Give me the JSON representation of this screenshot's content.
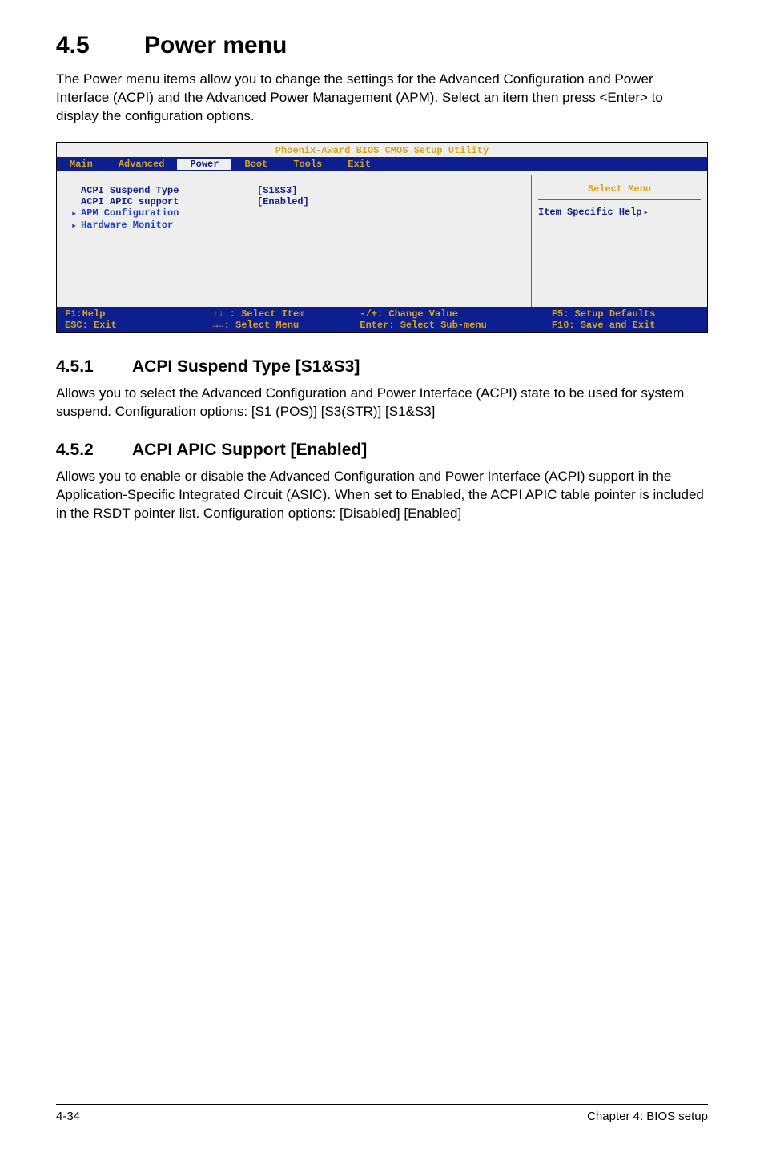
{
  "heading": {
    "number": "4.5",
    "title": "Power menu"
  },
  "intro": "The Power menu items allow you to change the settings for the Advanced Configuration and Power Interface (ACPI) and the Advanced Power Management (APM). Select an item then press <Enter> to display the configuration options.",
  "chart_data": {
    "type": "table",
    "title": "Phoenix-Award BIOS CMOS Setup Utility",
    "menubar": [
      "Main",
      "Advanced",
      "Power",
      "Boot",
      "Tools",
      "Exit"
    ],
    "active_tab": "Power",
    "rows": [
      {
        "label": "ACPI Suspend Type",
        "value": "[S1&S3]",
        "submenu": false
      },
      {
        "label": "ACPI APIC support",
        "value": "[Enabled]",
        "submenu": false
      },
      {
        "label": "APM Configuration",
        "value": "",
        "submenu": true
      },
      {
        "label": "Hardware Monitor",
        "value": "",
        "submenu": true
      }
    ],
    "side_title": "Select Menu",
    "side_help": "Item Specific Help",
    "footer": {
      "c1a": "F1:Help",
      "c1b": "ESC: Exit",
      "c2a": "↑↓ : Select Item",
      "c2b": "→←: Select Menu",
      "c3a": "-/+: Change Value",
      "c3b": "Enter: Select Sub-menu",
      "c4a": "F5: Setup Defaults",
      "c4b": "F10: Save and Exit"
    }
  },
  "sub1": {
    "number": "4.5.1",
    "title": "ACPI Suspend Type [S1&S3]",
    "body": "Allows you to select the Advanced Configuration and Power Interface (ACPI) state to be used for system suspend. Configuration options: [S1 (POS)] [S3(STR)] [S1&S3]"
  },
  "sub2": {
    "number": "4.5.2",
    "title": "ACPI APIC Support [Enabled]",
    "body": "Allows you to enable or disable the Advanced Configuration and Power Interface (ACPI) support in the Application-Specific Integrated Circuit (ASIC). When set to Enabled, the ACPI APIC table pointer is included in the RSDT pointer list. Configuration options: [Disabled] [Enabled]"
  },
  "footer": {
    "left": "4-34",
    "right": "Chapter 4: BIOS setup"
  }
}
